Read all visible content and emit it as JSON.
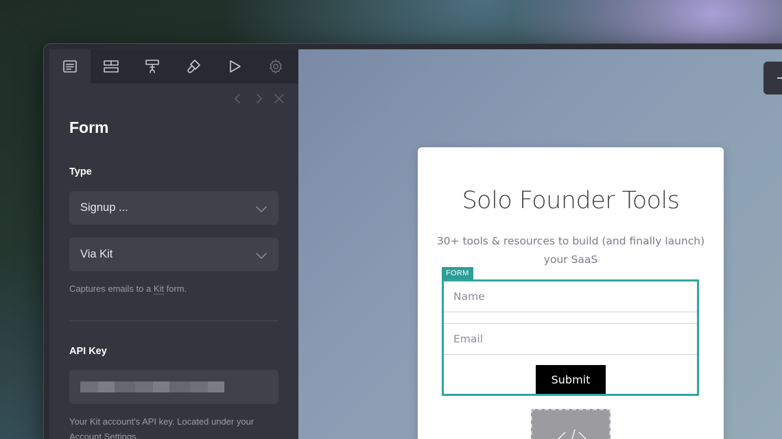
{
  "sidebar": {
    "toolbar": [
      {
        "icon": "document-lines-icon",
        "active": true
      },
      {
        "icon": "layout-blocks-icon"
      },
      {
        "icon": "text-hand-icon"
      },
      {
        "icon": "paint-brush-icon"
      },
      {
        "icon": "play-icon"
      },
      {
        "icon": "gear-icon",
        "dim": true
      }
    ],
    "nav": {
      "prev": "chevron-left-icon",
      "next": "chevron-right-icon",
      "close": "close-icon"
    },
    "title": "Form",
    "type_label": "Type",
    "type_value": "Signup ...",
    "provider_value": "Via Kit",
    "provider_help_pre": "Captures emails to a ",
    "provider_help_link": "Kit",
    "provider_help_post": " form.",
    "api_key_label": "API Key",
    "api_key_help": "Your Kit account's API key. Located under your Account Settings."
  },
  "card": {
    "title": "Solo Founder Tools",
    "subtitle": "30+ tools & resources to build (and finally launch) your SaaS",
    "form_tag": "FORM",
    "name_placeholder": "Name",
    "email_placeholder": "Email",
    "submit_label": "Submit",
    "embed_icon": "code-embed-icon"
  },
  "colors": {
    "sidebar_bg": "#34353e",
    "accent_teal": "#2fa59f",
    "button_black": "#000000"
  }
}
